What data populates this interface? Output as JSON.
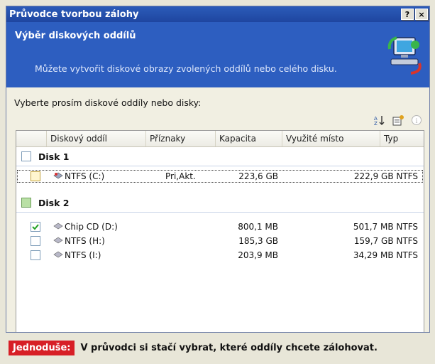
{
  "window": {
    "title": "Průvodce tvorbou zálohy",
    "help_button": "?",
    "close_button": "×"
  },
  "header": {
    "title": "Výběr diskových oddílů",
    "description": "Můžete vytvořit diskové obrazy zvolených oddílů nebo celého disku.",
    "icon": "computer-backup-icon"
  },
  "prompt": "Vyberte prosím diskové oddíly nebo disky:",
  "toolbar": {
    "icons": [
      "sort-icon",
      "properties-icon",
      "info-icon"
    ]
  },
  "list": {
    "columns": [
      "Diskový oddíl",
      "Příznaky",
      "Kapacita",
      "Využité místo",
      "Typ"
    ],
    "disks": [
      {
        "label": "Disk 1",
        "state": "unchecked",
        "partitions": [
          {
            "name": "NTFS (C:)",
            "flags": "Pri,Akt.",
            "capacity": "223,6 GB",
            "used": "222,9 GB NTFS",
            "checked": false,
            "focused": true
          }
        ]
      },
      {
        "label": "Disk 2",
        "state": "partial",
        "partitions": [
          {
            "name": "Chip CD (D:)",
            "flags": "",
            "capacity": "800,1 MB",
            "used": "501,7 MB NTFS",
            "checked": true,
            "focused": false
          },
          {
            "name": "NTFS (H:)",
            "flags": "",
            "capacity": "185,3 GB",
            "used": "159,7 GB NTFS",
            "checked": false,
            "focused": false
          },
          {
            "name": "NTFS (I:)",
            "flags": "",
            "capacity": "203,9 MB",
            "used": "34,29 MB NTFS",
            "checked": false,
            "focused": false
          }
        ]
      }
    ]
  },
  "caption": {
    "tag": "Jednoduše:",
    "text": "V průvodci si stačí vybrat, které oddíly chcete zálohovat."
  },
  "colors": {
    "titlebar": "#1f46a0",
    "header": "#2d5ec0",
    "caption_tag": "#d71f26"
  }
}
